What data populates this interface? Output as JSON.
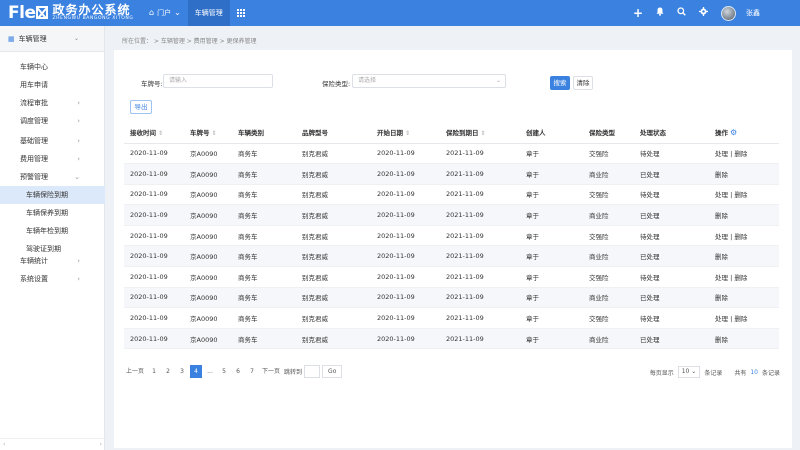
{
  "header": {
    "logo_mark": "Fle",
    "logo_cn": "政务办公系统",
    "logo_en": "ZHENGWU BANGONG XITONG",
    "nav": [
      {
        "icon": "home-icon",
        "label": "门户"
      },
      {
        "label": "车辆管理"
      }
    ],
    "username": "张鑫"
  },
  "sidebar": {
    "head": "车辆管理",
    "items": [
      {
        "label": "车辆中心"
      },
      {
        "label": "用车申请"
      },
      {
        "label": "流程审批"
      },
      {
        "label": "调度管理"
      },
      {
        "label": "基础管理"
      },
      {
        "label": "费用管理"
      },
      {
        "label": "预警管理"
      },
      {
        "label": "车辆保险到期"
      },
      {
        "label": "车辆保养到期"
      },
      {
        "label": "车辆年检到期"
      },
      {
        "label": "驾驶证到期"
      },
      {
        "label": "车辆统计"
      },
      {
        "label": "系统设置"
      }
    ],
    "foot_left": "‹",
    "foot_right": "›"
  },
  "breadcrumb": "所在位置： > 车辆管理 > 费用管理 > 更保养管理",
  "filters": {
    "plate_label": "车牌号:",
    "plate_placeholder": "请输入",
    "insurance_label": "保险类型:",
    "insurance_placeholder": "请选择",
    "search_label": "搜索",
    "clear_label": "清除",
    "export_label": "导出"
  },
  "table": {
    "headers": [
      "接收时间",
      "车牌号",
      "车辆类别",
      "品牌型号",
      "开始日期",
      "保险到期日",
      "创建人",
      "保险类型",
      "处理状态",
      "操作"
    ],
    "rows": [
      [
        "2020-11-09",
        "京A0090",
        "商务车",
        "别克君威",
        "2020-11-09",
        "2021-11-09",
        "章于",
        "交强险",
        "待处理",
        "处理 | 删除"
      ],
      [
        "2020-11-09",
        "京A0090",
        "商务车",
        "别克君威",
        "2020-11-09",
        "2021-11-09",
        "章于",
        "商业险",
        "已处理",
        "删除"
      ],
      [
        "2020-11-09",
        "京A0090",
        "商务车",
        "别克君威",
        "2020-11-09",
        "2021-11-09",
        "章于",
        "交强险",
        "待处理",
        "处理 | 删除"
      ],
      [
        "2020-11-09",
        "京A0090",
        "商务车",
        "别克君威",
        "2020-11-09",
        "2021-11-09",
        "章于",
        "商业险",
        "已处理",
        "删除"
      ],
      [
        "2020-11-09",
        "京A0090",
        "商务车",
        "别克君威",
        "2020-11-09",
        "2021-11-09",
        "章于",
        "交强险",
        "待处理",
        "处理 | 删除"
      ],
      [
        "2020-11-09",
        "京A0090",
        "商务车",
        "别克君威",
        "2020-11-09",
        "2021-11-09",
        "章于",
        "商业险",
        "已处理",
        "删除"
      ],
      [
        "2020-11-09",
        "京A0090",
        "商务车",
        "别克君威",
        "2020-11-09",
        "2021-11-09",
        "章于",
        "交强险",
        "待处理",
        "处理 | 删除"
      ],
      [
        "2020-11-09",
        "京A0090",
        "商务车",
        "别克君威",
        "2020-11-09",
        "2021-11-09",
        "章于",
        "商业险",
        "已处理",
        "删除"
      ],
      [
        "2020-11-09",
        "京A0090",
        "商务车",
        "别克君威",
        "2020-11-09",
        "2021-11-09",
        "章于",
        "交强险",
        "待处理",
        "处理 | 删除"
      ],
      [
        "2020-11-09",
        "京A0090",
        "商务车",
        "别克君威",
        "2020-11-09",
        "2021-11-09",
        "章于",
        "商业险",
        "已处理",
        "删除"
      ]
    ]
  },
  "pagination": {
    "prev": "上一页",
    "pages": [
      "1",
      "2",
      "3",
      "4",
      "...",
      "5",
      "6",
      "7"
    ],
    "current": "4",
    "next": "下一页",
    "jump_label": "跳转到",
    "go": "Go",
    "per_page_label": "每页显示",
    "per_page": "10",
    "per_page_suffix": "条记录",
    "total_prefix": "共有",
    "total": "10",
    "total_suffix": "条记录"
  },
  "colors": {
    "primary": "#3b82e0",
    "active_menu": "#dce9fa"
  }
}
